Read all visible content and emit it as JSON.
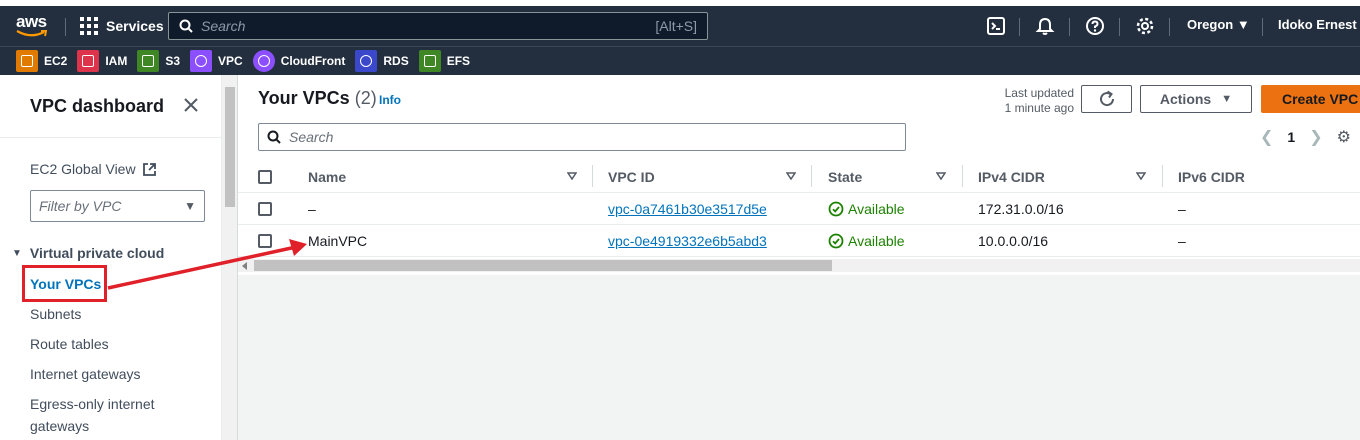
{
  "topnav": {
    "logo_text": "aws",
    "services_label": "Services",
    "search_placeholder": "Search",
    "search_shortcut": "[Alt+S]",
    "region": "Oregon",
    "account": "Idoko Ernest Cl",
    "icons": [
      "cloudshell-icon",
      "bell-icon",
      "help-icon",
      "gear-icon"
    ]
  },
  "favorites": [
    {
      "label": "EC2",
      "color": "#e07b00"
    },
    {
      "label": "IAM",
      "color": "#dd344c"
    },
    {
      "label": "S3",
      "color": "#3f8624"
    },
    {
      "label": "VPC",
      "color": "#8c4fff"
    },
    {
      "label": "CloudFront",
      "color": "#8c4fff"
    },
    {
      "label": "RDS",
      "color": "#3b48cc"
    },
    {
      "label": "EFS",
      "color": "#3f8624"
    }
  ],
  "sidebar": {
    "title": "VPC dashboard",
    "ec2_global_view": "EC2 Global View",
    "filter_placeholder": "Filter by VPC",
    "section": "Virtual private cloud",
    "items": [
      "Your VPCs",
      "Subnets",
      "Route tables",
      "Internet gateways",
      "Egress-only internet",
      "gateways"
    ]
  },
  "main": {
    "title": "Your VPCs",
    "count": "(2)",
    "info": "Info",
    "last_updated_line1": "Last updated",
    "last_updated_line2": "1 minute ago",
    "actions_label": "Actions",
    "create_label": "Create VPC",
    "search_placeholder": "Search",
    "page": "1",
    "columns": [
      "Name",
      "VPC ID",
      "State",
      "IPv4 CIDR",
      "IPv6 CIDR"
    ],
    "rows": [
      {
        "name": "–",
        "vpc_id": "vpc-0a7461b30e3517d5e",
        "state": "Available",
        "ipv4": "172.31.0.0/16",
        "ipv6": "–"
      },
      {
        "name": "MainVPC",
        "vpc_id": "vpc-0e4919332e6b5abd3",
        "state": "Available",
        "ipv4": "10.0.0.0/16",
        "ipv6": "–"
      }
    ]
  },
  "colors": {
    "nav_bg": "#232f3e",
    "link": "#0073bb",
    "primary": "#ec7211",
    "available": "#1d8102",
    "annotation": "#e0212a"
  }
}
